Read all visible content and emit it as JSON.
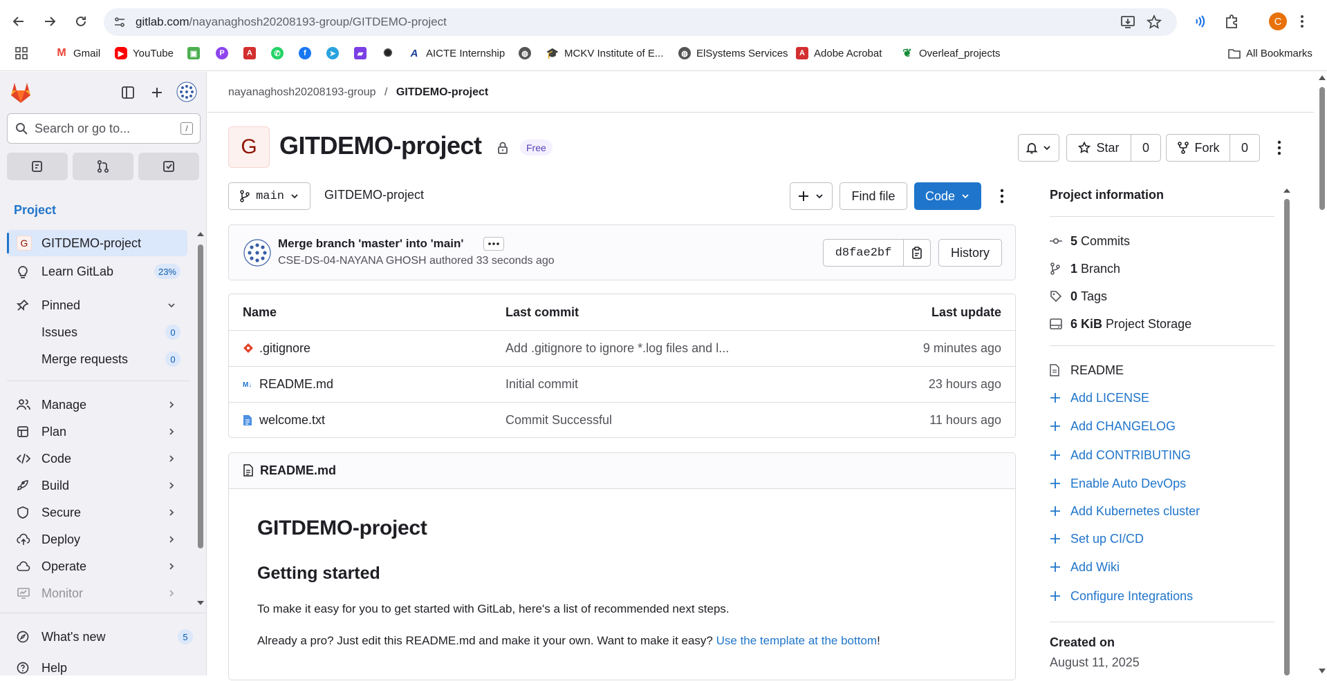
{
  "browser": {
    "url_host": "gitlab.com",
    "url_path": "/nayanaghosh20208193-group/GITDEMO-project",
    "profile_initial": "C",
    "bookmarks": [
      "Gmail",
      "YouTube",
      "AICTE Internship",
      "MCKV Institute of E...",
      "ElSystems Services",
      "Adobe Acrobat",
      "Overleaf_projects"
    ],
    "all_bookmarks": "All Bookmarks"
  },
  "sidebar": {
    "search_placeholder": "Search or go to...",
    "search_shortcut": "/",
    "section_heading": "Project",
    "project_initial": "G",
    "project_name": "GITDEMO-project",
    "learn": {
      "label": "Learn GitLab",
      "badge": "23%"
    },
    "pinned": {
      "label": "Pinned",
      "items": [
        {
          "label": "Issues",
          "count": "0"
        },
        {
          "label": "Merge requests",
          "count": "0"
        }
      ]
    },
    "menu": [
      "Manage",
      "Plan",
      "Code",
      "Build",
      "Secure",
      "Deploy",
      "Operate",
      "Monitor"
    ],
    "whats_new": {
      "label": "What's new",
      "count": "5"
    },
    "help": "Help"
  },
  "breadcrumb": {
    "group": "nayanaghosh20208193-group",
    "separator": "/",
    "project": "GITDEMO-project"
  },
  "project": {
    "initial": "G",
    "title": "GITDEMO-project",
    "badge": "Free",
    "star_label": "Star",
    "star_count": "0",
    "fork_label": "Fork",
    "fork_count": "0"
  },
  "repo_toolbar": {
    "branch": "main",
    "path": "GITDEMO-project",
    "find_file": "Find file",
    "code": "Code"
  },
  "last_commit": {
    "message": "Merge branch 'master' into 'main'",
    "author": "CSE-DS-04-NAYANA GHOSH",
    "action": "authored",
    "time": "33 seconds ago",
    "sha": "d8fae2bf",
    "history": "History"
  },
  "files": {
    "headers": [
      "Name",
      "Last commit",
      "Last update"
    ],
    "rows": [
      {
        "name": ".gitignore",
        "commit": "Add .gitignore to ignore *.log files and l...",
        "updated": "9 minutes ago"
      },
      {
        "name": "README.md",
        "commit": "Initial commit",
        "updated": "23 hours ago"
      },
      {
        "name": "welcome.txt",
        "commit": "Commit Successful",
        "updated": "11 hours ago"
      }
    ]
  },
  "readme": {
    "file": "README.md",
    "h1": "GITDEMO-project",
    "h2": "Getting started",
    "p1": "To make it easy for you to get started with GitLab, here's a list of recommended next steps.",
    "p2_before": "Already a pro? Just edit this README.md and make it your own. Want to make it easy? ",
    "p2_link": "Use the template at the bottom",
    "p2_after": "!"
  },
  "project_info": {
    "heading": "Project information",
    "commits": {
      "count": "5",
      "label": "Commits"
    },
    "branches": {
      "count": "1",
      "label": "Branch"
    },
    "tags": {
      "count": "0",
      "label": "Tags"
    },
    "storage": {
      "count": "6 KiB",
      "label": "Project Storage"
    },
    "readme": "README",
    "links": [
      "Add LICENSE",
      "Add CHANGELOG",
      "Add CONTRIBUTING",
      "Enable Auto DevOps",
      "Add Kubernetes cluster",
      "Set up CI/CD",
      "Add Wiki",
      "Configure Integrations"
    ],
    "created_label": "Created on",
    "created_date": "August 11, 2025"
  },
  "colors": {
    "accent": "#1f75cb",
    "brand": "#e24329",
    "sidebar_bg": "#f1f0f4"
  }
}
